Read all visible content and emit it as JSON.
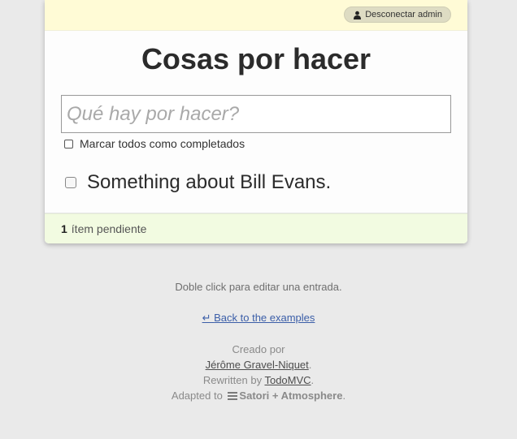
{
  "login_bar": {
    "logout_label": "Desconectar admin",
    "logout_icon": "user-icon"
  },
  "header": {
    "title": "Cosas por hacer"
  },
  "new_todo": {
    "placeholder": "Qué hay por hacer?",
    "value": ""
  },
  "toggle_all": {
    "label": "Marcar todos como completados",
    "checked": false
  },
  "todos": [
    {
      "title": "Something about Bill Evans.",
      "completed": false
    }
  ],
  "footer": {
    "count": "1",
    "count_label": "ítem pendiente"
  },
  "info": {
    "hint": "Doble click para editar una entrada.",
    "back_arrow": "↵",
    "back_link": "Back to the examples",
    "created_by": "Creado por",
    "author": "Jérôme Gravel-Niquet",
    "author_suffix": ".",
    "rewritten_by": "Rewritten by",
    "rewriter": "TodoMVC",
    "rewriter_suffix": ".",
    "adapted_to": "Adapted to",
    "brand_icon": "hamburger-icon",
    "brand": "Satori + Atmosphere",
    "brand_suffix": "."
  },
  "colors": {
    "background": "#eaeaea",
    "login_bar": "#fffbd6",
    "footer": "#f2fbe1",
    "link": "#3b5ea8"
  }
}
